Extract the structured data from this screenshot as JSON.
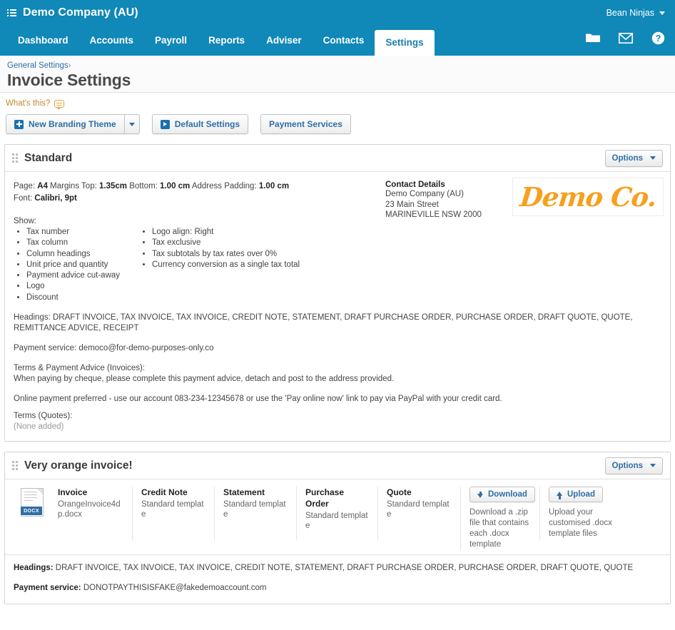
{
  "topbar": {
    "menu_icon": "list-icon",
    "org_name": "Demo Company (AU)",
    "user_menu": "Bean Ninjas",
    "user_caret": "chevron-down-icon"
  },
  "nav": {
    "items": [
      {
        "label": "Dashboard",
        "active": false
      },
      {
        "label": "Accounts",
        "active": false
      },
      {
        "label": "Payroll",
        "active": false
      },
      {
        "label": "Reports",
        "active": false
      },
      {
        "label": "Adviser",
        "active": false
      },
      {
        "label": "Contacts",
        "active": false
      },
      {
        "label": "Settings",
        "active": true
      }
    ],
    "icons": [
      "folder-icon",
      "envelope-icon",
      "help-icon"
    ]
  },
  "page": {
    "breadcrumb": "General Settings",
    "breadcrumb_sep": "›",
    "title": "Invoice Settings",
    "whats_this": "What's this?"
  },
  "toolbar": {
    "new_branding_theme": "New Branding Theme",
    "default_settings": "Default Settings",
    "payment_services": "Payment Services"
  },
  "panels": [
    {
      "title": "Standard",
      "options_label": "Options",
      "page_meta": {
        "page_label": "Page:",
        "page_value": "A4",
        "margins_top_label": "Margins Top:",
        "margins_top_value": "1.35cm",
        "bottom_label": "Bottom:",
        "bottom_value": "1.00 cm",
        "address_padding_label": "Address Padding:",
        "address_padding_value": "1.00 cm",
        "font_label": "Font:",
        "font_value": "Calibri, 9pt"
      },
      "show_label": "Show:",
      "show_col1": [
        "Tax number",
        "Tax column",
        "Column headings",
        "Unit price and quantity",
        "Payment advice cut-away",
        "Logo",
        "Discount"
      ],
      "show_col2": [
        "Logo align: Right",
        "Tax exclusive",
        "Tax subtotals by tax rates over 0%",
        "Currency conversion as a single tax total"
      ],
      "contact": {
        "title": "Contact Details",
        "lines": [
          "Demo Company (AU)",
          "23 Main Street",
          "MARINEVILLE NSW 2000"
        ]
      },
      "logo_text": "Demo Co.",
      "logo_color": "#f5a01e",
      "headings_label": "Headings:",
      "headings_value": "DRAFT INVOICE, TAX INVOICE, TAX INVOICE, CREDIT NOTE, STATEMENT, DRAFT PURCHASE ORDER, PURCHASE ORDER, DRAFT QUOTE, QUOTE, REMITTANCE ADVICE, RECEIPT",
      "payment_service_label": "Payment service:",
      "payment_service_value": "democo@for-demo-purposes-only.co",
      "terms_invoices_label": "Terms & Payment Advice (Invoices):",
      "terms_invoices_line1": "When paying by cheque, please complete this payment advice, detach and post to the address provided.",
      "terms_invoices_line2": "Online payment preferred - use our account 083-234-12345678 or use the 'Pay online now' link to pay via PayPal with your credit card.",
      "terms_quotes_label": "Terms (Quotes):",
      "terms_quotes_value": "(None added)"
    },
    {
      "title": "Very orange invoice!",
      "options_label": "Options",
      "file_icon_label": "DOCX",
      "templates": [
        {
          "name": "Invoice",
          "sub": "OrangeInvoice4dp.docx"
        },
        {
          "name": "Credit Note",
          "sub": "Standard template"
        },
        {
          "name": "Statement",
          "sub": "Standard template"
        },
        {
          "name": "Purchase Order",
          "sub": "Standard template"
        },
        {
          "name": "Quote",
          "sub": "Standard template"
        }
      ],
      "download": {
        "label": "Download",
        "help": "Download a .zip file that contains each .docx template"
      },
      "upload": {
        "label": "Upload",
        "help": "Upload your customised .docx template files"
      },
      "headings_label": "Headings:",
      "headings_value": "DRAFT INVOICE, TAX INVOICE, TAX INVOICE, CREDIT NOTE, STATEMENT, DRAFT PURCHASE ORDER, PURCHASE ORDER, DRAFT QUOTE, QUOTE",
      "payment_service_label": "Payment service:",
      "payment_service_value": "DONOTPAYTHISISFAKE@fakedemoaccount.com"
    }
  ],
  "colors": {
    "brand_blue": "#1088b8",
    "link_blue": "#2e6ea6",
    "accent_orange": "#f5a01e"
  }
}
